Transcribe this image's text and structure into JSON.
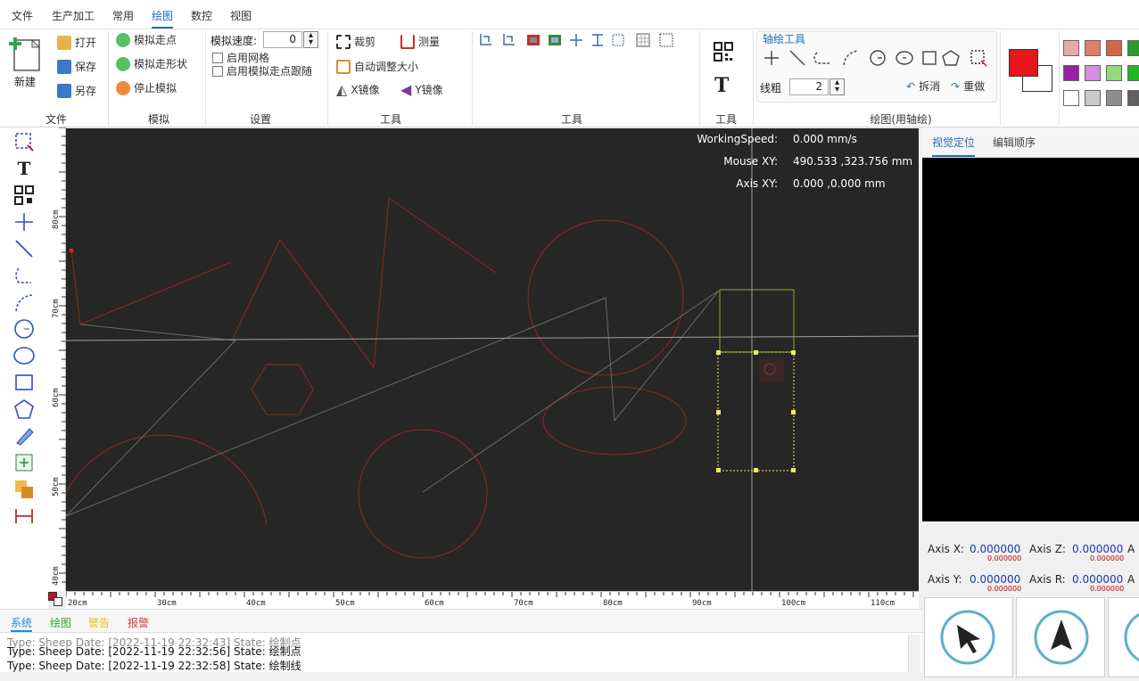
{
  "menu": {
    "items": [
      "文件",
      "生产加工",
      "常用",
      "绘图",
      "数控",
      "视图"
    ],
    "active": "绘图"
  },
  "ribbon": {
    "file": {
      "new": "新建",
      "open": "打开",
      "save": "保存",
      "saveas": "另存",
      "title": "文件"
    },
    "simulate": {
      "walk_point": "模拟走点",
      "walk_shape": "模拟走形状",
      "stop": "停止模拟",
      "title": "模拟"
    },
    "settings": {
      "speed_label": "模拟速度:",
      "speed_value": "0",
      "grid": "启用网格",
      "follow": "启用模拟走点跟随",
      "title": "设置"
    },
    "tools1": {
      "crop": "裁剪",
      "measure": "测量",
      "autosize": "自动调整大小",
      "xmirror": "X镜像",
      "ymirror": "Y镜像",
      "title": "工具"
    },
    "tools2": {
      "title": "工具"
    },
    "tools3": {
      "title": "工具"
    },
    "draw": {
      "axis_tools": "轴绘工具",
      "line_width_label": "线粗",
      "line_width_value": "2",
      "undo": "拆消",
      "redo": "重做",
      "title": "绘图(用轴绘)"
    }
  },
  "colors": {
    "foreground": "#e8161c",
    "background": "#ffffff",
    "palette": [
      [
        "#e9a7a7",
        "#e07d6c",
        "#d56548",
        "#2c9b2c"
      ],
      [
        "#9a1fa8",
        "#d48de0",
        "#92d97a",
        "#24b424"
      ],
      [
        "#ffffff",
        "#c9c9c9",
        "#8e8e8e",
        "#606060"
      ]
    ]
  },
  "canvas": {
    "overlay": {
      "working_speed_label": "WorkingSpeed:",
      "working_speed_value": "0.000 mm/s",
      "mouse_label": "Mouse XY:",
      "mouse_value": "490.533 ,323.756 mm",
      "axis_label": "Axis XY:",
      "axis_value": "0.000 ,0.000 mm"
    },
    "hruler_labels": [
      "20cm",
      "30cm",
      "40cm",
      "50cm",
      "60cm",
      "70cm",
      "80cm",
      "90cm",
      "100cm",
      "110cm"
    ],
    "vruler_labels": [
      "80cm",
      "70cm",
      "60cm",
      "50cm",
      "40cm"
    ]
  },
  "right_panel": {
    "tabs": [
      "视觉定位",
      "编辑顺序"
    ],
    "active_tab": "视觉定位",
    "axes": [
      {
        "label": "Axis X:",
        "value": "0.000000",
        "sub": "0.000000"
      },
      {
        "label": "Axis Z:",
        "value": "0.000000",
        "sub": "0.000000"
      },
      {
        "label": "Axis Y:",
        "value": "0.000000",
        "sub": "0.000000"
      },
      {
        "label": "Axis R:",
        "value": "0.000000",
        "sub": "0.000000"
      }
    ],
    "axis_partial": "A"
  },
  "bottom": {
    "tabs": [
      "系统",
      "绘图",
      "警告",
      "报警"
    ],
    "tab_colors": [
      "#1f8fd1",
      "#29a829",
      "#e2c313",
      "#e23a3a"
    ],
    "logs": [
      "Type: Sheep  Date: [2022-11-19 22:32:56]  State: 绘制点",
      "Type: Sheep  Date: [2022-11-19 22:32:58]  State: 绘制线"
    ]
  }
}
